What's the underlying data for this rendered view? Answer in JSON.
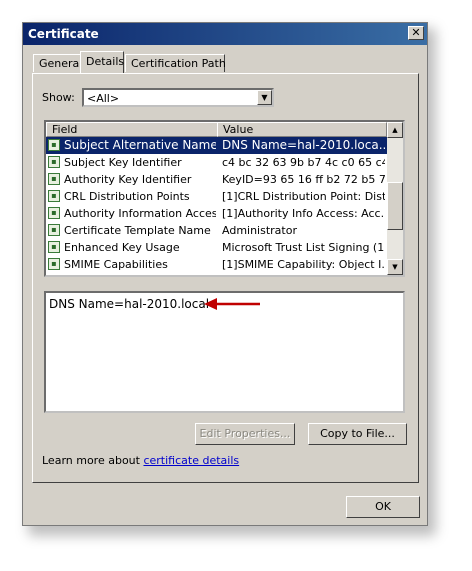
{
  "window": {
    "title": "Certificate",
    "close_symbol": "✕"
  },
  "tabs": [
    {
      "label": "General"
    },
    {
      "label": "Details"
    },
    {
      "label": "Certification Path"
    }
  ],
  "show": {
    "label": "Show:",
    "value": "<All>"
  },
  "list": {
    "columns": [
      "Field",
      "Value"
    ],
    "rows": [
      {
        "field": "Subject Alternative Name",
        "value": "DNS Name=hal-2010.loca...",
        "selected": true
      },
      {
        "field": "Subject Key Identifier",
        "value": "c4 bc 32 63 9b b7 4c c0 65 c4 ..."
      },
      {
        "field": "Authority Key Identifier",
        "value": "KeyID=93 65 16 ff b2 72 b5 7..."
      },
      {
        "field": "CRL Distribution Points",
        "value": "[1]CRL Distribution Point: Distr..."
      },
      {
        "field": "Authority Information Access",
        "value": "[1]Authority Info Access: Acc..."
      },
      {
        "field": "Certificate Template Name",
        "value": "Administrator"
      },
      {
        "field": "Enhanced Key Usage",
        "value": "Microsoft Trust List Signing (1...."
      },
      {
        "field": "SMIME Capabilities",
        "value": "[1]SMIME Capability: Object I..."
      }
    ]
  },
  "detail": {
    "text": "DNS Name=hal-2010.local",
    "arrow_color": "#c00000"
  },
  "buttons": {
    "edit_properties": "Edit Properties...",
    "copy_to_file": "Copy to File...",
    "ok": "OK"
  },
  "learn": {
    "prefix": "Learn more about ",
    "link": "certificate details"
  }
}
